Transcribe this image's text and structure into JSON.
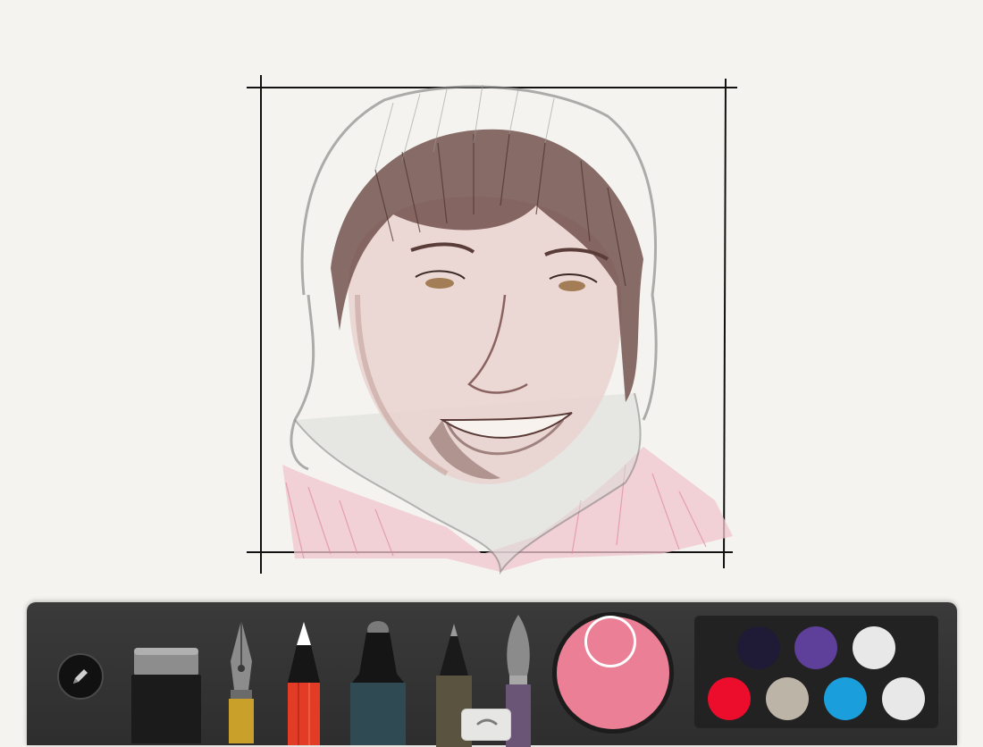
{
  "canvas": {
    "paper_color": "#f4f3ef",
    "frame_color": "#111111",
    "sketch": "hooded-portrait"
  },
  "toolbar": {
    "tools": [
      {
        "name": "eraser",
        "icon": "eraser-icon"
      },
      {
        "name": "fountain-pen",
        "icon": "fountain-pen-icon",
        "accent": "#c9a12a"
      },
      {
        "name": "pencil",
        "icon": "pencil-icon",
        "accent": "#e23b26"
      },
      {
        "name": "marker",
        "icon": "marker-icon",
        "accent": "#2f4a52"
      },
      {
        "name": "fineliner",
        "icon": "fineliner-icon",
        "accent": "#5a5340"
      },
      {
        "name": "watercolor-brush",
        "icon": "brush-icon",
        "accent": "#6a5577"
      }
    ],
    "selected_color": "#ea7f95",
    "palette": [
      "#1f1a35",
      "#5e3f9a",
      "#e8e8e8",
      "#ec0c2c",
      "#bcb4a7",
      "#1a9fdc",
      "#e8e8e8"
    ]
  }
}
